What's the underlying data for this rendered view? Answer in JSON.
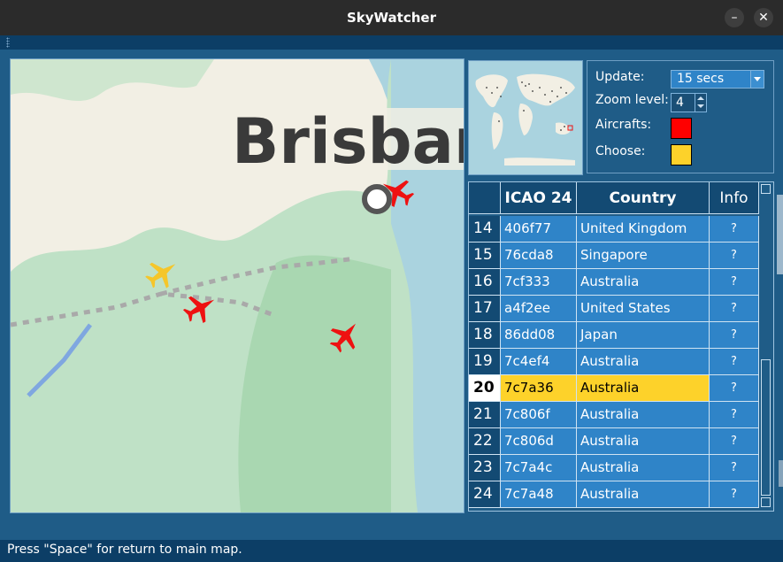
{
  "window": {
    "title": "SkyWatcher"
  },
  "map": {
    "city_label": "Brisbar",
    "planes": [
      "red-plane",
      "red-plane",
      "yellow-plane",
      "red-plane"
    ]
  },
  "settings": {
    "update_label": "Update:",
    "update_value": "15 secs",
    "zoom_label": "Zoom level:",
    "zoom_value": "4",
    "aircrafts_label": "Aircrafts:",
    "aircrafts_color": "#ff0000",
    "choose_label": "Choose:",
    "choose_color": "#fdd22a"
  },
  "table": {
    "headers": {
      "icao": "ICAO 24",
      "country": "Country",
      "info": "Info"
    },
    "rows": [
      {
        "n": "14",
        "icao": "406f77",
        "country": "United Kingdom",
        "info": "?"
      },
      {
        "n": "15",
        "icao": "76cda8",
        "country": "Singapore",
        "info": "?"
      },
      {
        "n": "16",
        "icao": "7cf333",
        "country": "Australia",
        "info": "?"
      },
      {
        "n": "17",
        "icao": "a4f2ee",
        "country": "United States",
        "info": "?"
      },
      {
        "n": "18",
        "icao": "86dd08",
        "country": "Japan",
        "info": "?"
      },
      {
        "n": "19",
        "icao": "7c4ef4",
        "country": "Australia",
        "info": "?"
      },
      {
        "n": "20",
        "icao": "7c7a36",
        "country": "Australia",
        "info": "?",
        "selected": true
      },
      {
        "n": "21",
        "icao": "7c806f",
        "country": "Australia",
        "info": "?"
      },
      {
        "n": "22",
        "icao": "7c806d",
        "country": "Australia",
        "info": "?"
      },
      {
        "n": "23",
        "icao": "7c7a4c",
        "country": "Australia",
        "info": "?"
      },
      {
        "n": "24",
        "icao": "7c7a48",
        "country": "Australia",
        "info": "?"
      }
    ]
  },
  "status": {
    "text": "Press \"Space\" for return to main map."
  },
  "colors": {
    "window_bg": "#1f5c87",
    "cell_bg": "#2f84c8",
    "selected": "#fdd22a",
    "plane": "#ff0000"
  }
}
